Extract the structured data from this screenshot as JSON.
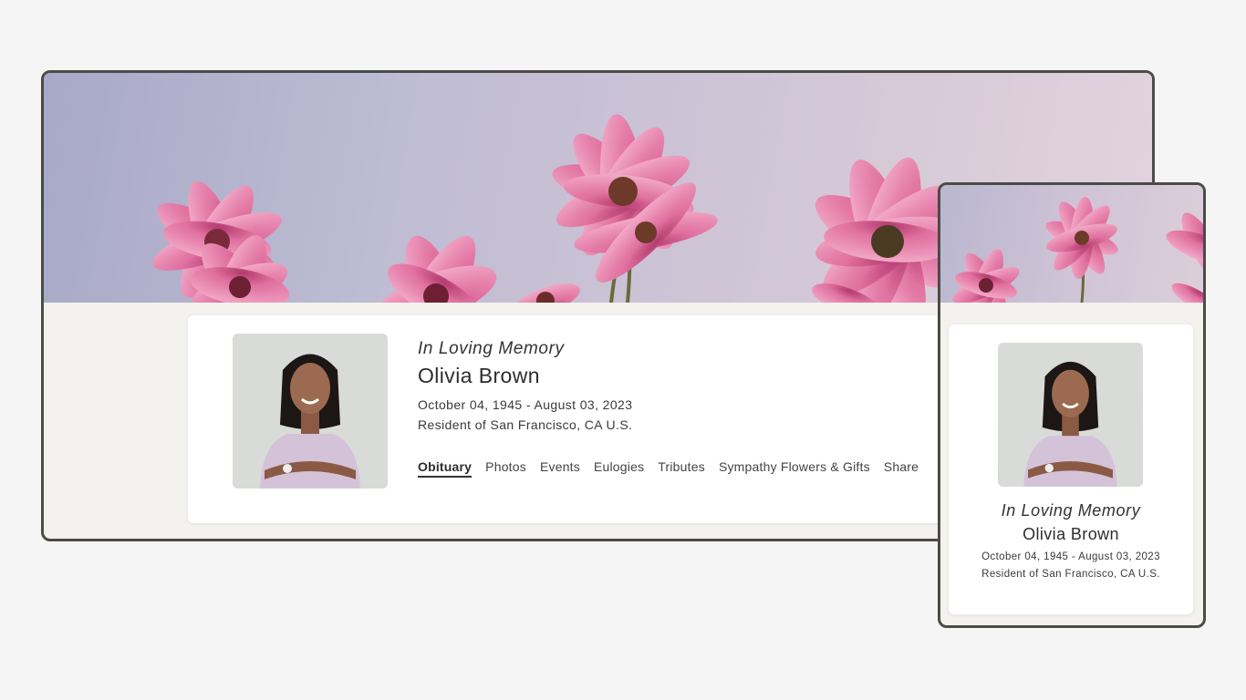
{
  "desktop": {
    "header_image": "pink-cosmos-flowers-banner",
    "memory_title": "In Loving Memory",
    "name": "Olivia Brown",
    "dates": "October 04, 1945 - August 03, 2023",
    "residence": "Resident of San Francisco, CA U.S.",
    "tabs": [
      {
        "label": "Obituary",
        "active": true
      },
      {
        "label": "Photos",
        "active": false
      },
      {
        "label": "Events",
        "active": false
      },
      {
        "label": "Eulogies",
        "active": false
      },
      {
        "label": "Tributes",
        "active": false
      },
      {
        "label": "Sympathy Flowers & Gifts",
        "active": false
      },
      {
        "label": "Share",
        "active": false
      }
    ]
  },
  "mobile": {
    "header_image": "pink-cosmos-flowers-banner",
    "memory_title": "In Loving Memory",
    "name": "Olivia Brown",
    "dates": "October 04, 1945 - August 03, 2023",
    "residence": "Resident of San Francisco, CA U.S."
  },
  "colors": {
    "page_background": "#f5f5f5",
    "frame_border": "#4b4b47",
    "card_area_background": "#f3f2ee",
    "petal_pink": "#e27aa6",
    "sky_lavender": "#b8b7d0"
  }
}
